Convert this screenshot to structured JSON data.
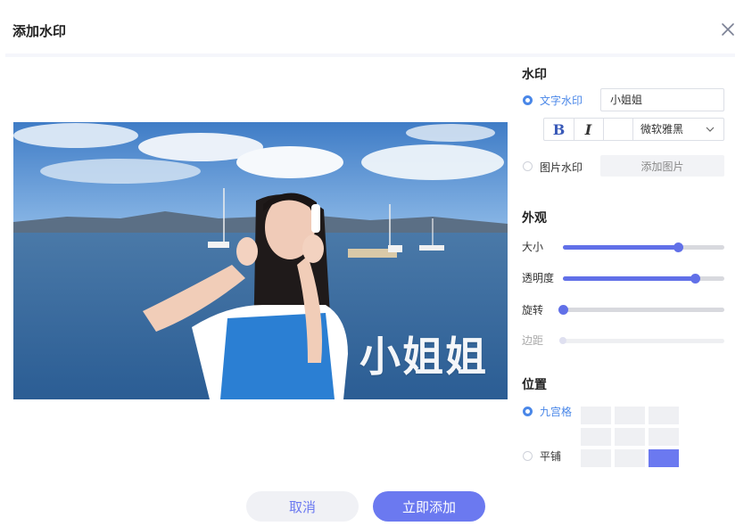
{
  "dialog": {
    "title": "添加水印"
  },
  "preview": {
    "watermark_text": "小姐姐"
  },
  "watermark": {
    "section_title": "水印",
    "text_option_label": "文字水印",
    "text_value": "小姐姐",
    "bold_label": "B",
    "italic_label": "I",
    "font_value": "微软雅黑",
    "image_option_label": "图片水印",
    "add_image_label": "添加图片",
    "selected": "text"
  },
  "appearance": {
    "section_title": "外观",
    "sliders": [
      {
        "label": "大小",
        "value": 0.71,
        "enabled": true
      },
      {
        "label": "透明度",
        "value": 0.82,
        "enabled": true
      },
      {
        "label": "旋转",
        "value": 0.0,
        "enabled": true
      },
      {
        "label": "边距",
        "value": 0.0,
        "enabled": false
      }
    ]
  },
  "position": {
    "section_title": "位置",
    "nine_grid_label": "九宫格",
    "tile_label": "平铺",
    "selected_mode": "nine_grid",
    "selected_cell": 8
  },
  "footer": {
    "cancel_label": "取消",
    "confirm_label": "立即添加"
  },
  "colors": {
    "accent": "#6b79f0",
    "radio_active": "#4a87e8"
  }
}
